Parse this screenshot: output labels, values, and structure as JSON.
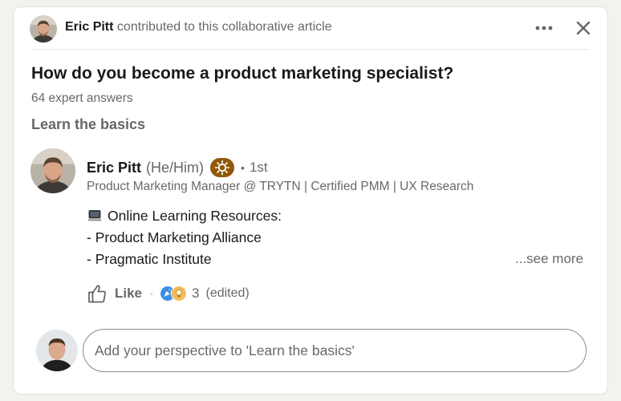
{
  "header": {
    "contributor_name": "Eric Pitt",
    "contributor_text": "contributed to this collaborative article",
    "more_icon": "ellipsis-icon",
    "close_icon": "close-icon"
  },
  "article": {
    "title": "How do you become a product marketing specialist?",
    "answers_count": "64 expert answers",
    "section": "Learn the basics"
  },
  "contribution": {
    "author_name": "Eric Pitt",
    "pronouns": "(He/Him)",
    "badge_icon": "top-voice-lightbulb-icon",
    "separator": "•",
    "degree": "1st",
    "headline": "Product Marketing Manager @ TRYTN | Certified PMM | UX Research",
    "lines": [
      "Online Learning Resources:",
      "- Product Marketing Alliance",
      "- Pragmatic Institute"
    ],
    "leading_icon": "laptop-icon",
    "see_more": "...see more",
    "like_label": "Like",
    "action_separator": "·",
    "reactions_count": "3",
    "edited": "(edited)",
    "reaction_icons": [
      "celebrate-icon",
      "insightful-icon"
    ]
  },
  "composer": {
    "placeholder": "Add your perspective to 'Learn the basics'"
  },
  "colors": {
    "badge": "#915907",
    "celebrate": "#378fe9",
    "insightful": "#f5bb5c",
    "page_bg": "#f4f2ee"
  }
}
